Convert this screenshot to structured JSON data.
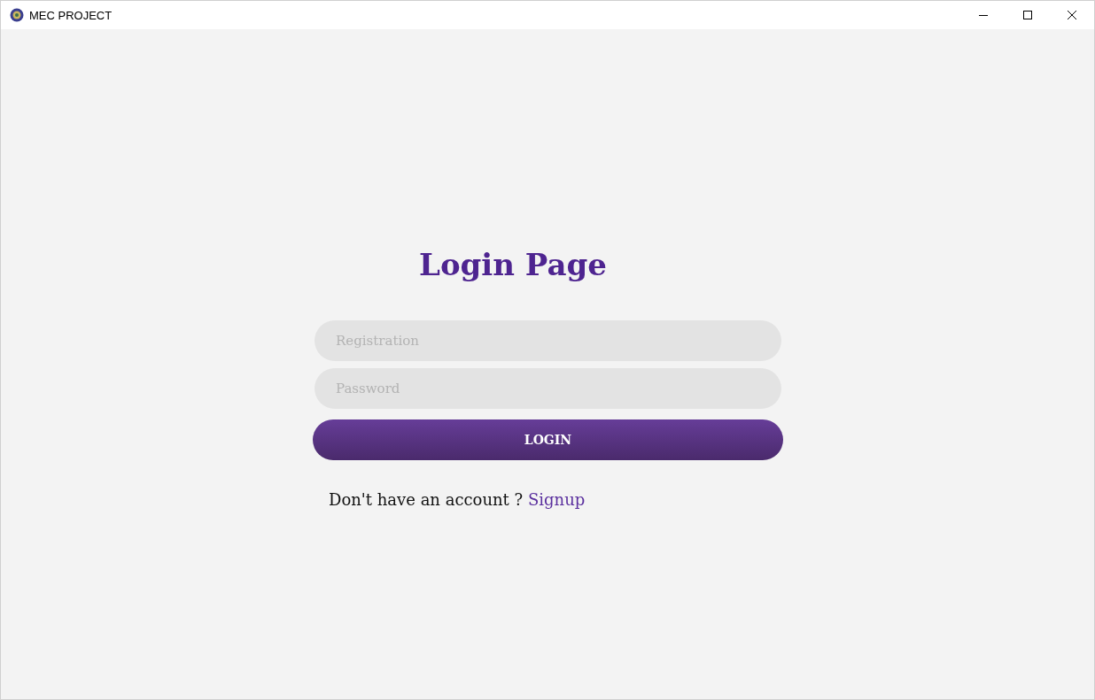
{
  "window": {
    "title": "MEC PROJECT"
  },
  "heading": "Login Page",
  "fields": [
    {
      "placeholder": "Registration"
    },
    {
      "placeholder": "Password"
    }
  ],
  "login_button": "LOGIN",
  "signup_prompt": {
    "text": "Don't have an account ?",
    "link": "Signup"
  }
}
